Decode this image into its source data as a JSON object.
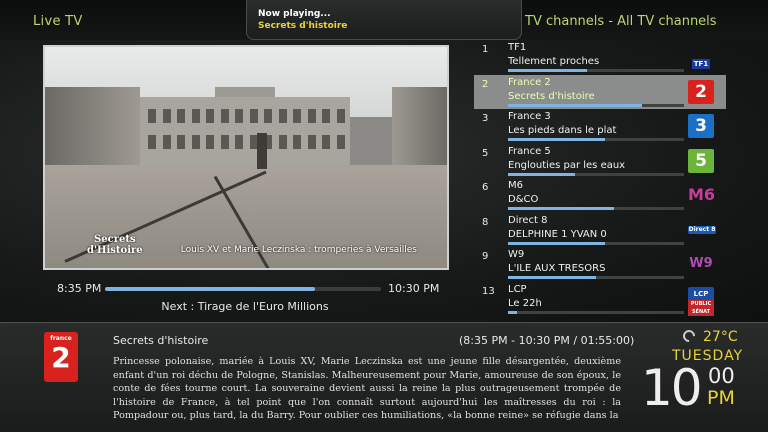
{
  "header": {
    "section_title": "Live TV",
    "channels_title": "TV channels  - All TV channels",
    "now_playing_label": "Now playing...",
    "now_playing_title": "Secrets d'histoire"
  },
  "player": {
    "overlay_logo_line1": "Secrets",
    "overlay_logo_line2": "d'Histoire",
    "subtitle": "Louis XV et Marie Leczinska : tromperies à Versailles",
    "start_time": "8:35 PM",
    "end_time": "10:30 PM",
    "progress_fraction": 0.76,
    "next_text": "Next : Tirage de l'Euro Millions"
  },
  "channels": [
    {
      "number": "1",
      "name": "TF1",
      "program": "Tellement proches",
      "progress": 0.45,
      "logo": "TF1",
      "selected": false
    },
    {
      "number": "2",
      "name": "France 2",
      "program": "Secrets d'histoire",
      "progress": 0.76,
      "logo": "2",
      "selected": true
    },
    {
      "number": "3",
      "name": "France 3",
      "program": "Les pieds dans le plat",
      "progress": 0.55,
      "logo": "3",
      "selected": false
    },
    {
      "number": "5",
      "name": "France 5",
      "program": "Englouties par les eaux",
      "progress": 0.38,
      "logo": "5",
      "selected": false
    },
    {
      "number": "6",
      "name": "M6",
      "program": "D&CO",
      "progress": 0.6,
      "logo": "M6",
      "selected": false
    },
    {
      "number": "8",
      "name": "Direct 8",
      "program": "DELPHINE 1 YVAN 0",
      "progress": 0.55,
      "logo": "Direct 8",
      "selected": false
    },
    {
      "number": "9",
      "name": "W9",
      "program": "L'ILE AUX TRESORS",
      "progress": 0.5,
      "logo": "W9",
      "selected": false
    },
    {
      "number": "13",
      "name": "LCP",
      "program": "Le 22h",
      "progress": 0.05,
      "logo": "LCP",
      "logo_sub": "PUBLIC SÉNAT",
      "selected": false
    }
  ],
  "info": {
    "channel_logo_small": "france",
    "channel_logo_big": "2",
    "program_title": "Secrets d'histoire",
    "program_time": "(8:35 PM - 10:30 PM / 01:55:00)",
    "synopsis": "Princesse polonaise, mariée à Louis XV, Marie Leczinska est une jeune fille désargentée, deuxième enfant d'un roi déchu de Pologne, Stanislas. Malheureusement pour Marie, amoureuse de son époux, le conte de fées tourne court. La souveraine devient aussi la reine la plus outrageusement trompée de l'histoire de France, à tel point que l'on connaît surtout aujourd'hui les maîtresses du roi : la Pompadour ou, plus tard, la du Barry. Pour oublier ces humiliations, «la bonne reine» se réfugie dans la"
  },
  "status": {
    "weather_icon": "moon-icon",
    "temperature": "27°C",
    "day": "TUESDAY",
    "hour": "10",
    "minute": "00",
    "ampm": "PM"
  },
  "colors": {
    "accent_green": "#b8d870",
    "accent_yellow": "#e8d23a",
    "progress_blue": "#7fb3e0",
    "selected_row": "#8a8d8c"
  }
}
